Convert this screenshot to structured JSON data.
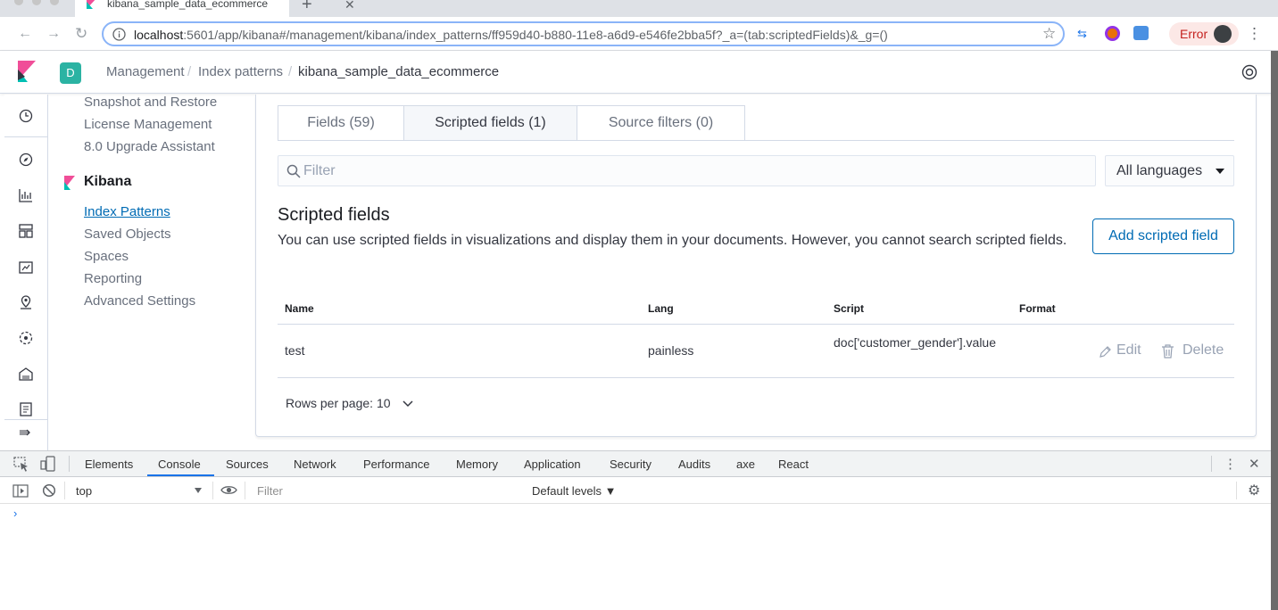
{
  "browser": {
    "tab_title": "kibana_sample_data_ecommerce",
    "new_tab": "+",
    "url_host": "localhost",
    "url_rest": ":5601/app/kibana#/management/kibana/index_patterns/ff959d40-b880-11e8-a6d9-e546fe2bba5f?_a=(tab:scriptedFields)&_g=()",
    "error_label": "Error"
  },
  "header": {
    "space_initial": "D",
    "breadcrumbs": [
      "Management",
      "Index patterns",
      "kibana_sample_data_ecommerce"
    ]
  },
  "sidebar": {
    "top_links": [
      "Snapshot and Restore",
      "License Management",
      "8.0 Upgrade Assistant"
    ],
    "section_title": "Kibana",
    "kibana_links": [
      "Index Patterns",
      "Saved Objects",
      "Spaces",
      "Reporting",
      "Advanced Settings"
    ]
  },
  "tabs": [
    {
      "label": "Fields (59)"
    },
    {
      "label": "Scripted fields (1)"
    },
    {
      "label": "Source filters (0)"
    }
  ],
  "filter": {
    "placeholder": "Filter"
  },
  "language_select": {
    "value": "All languages"
  },
  "scripted": {
    "title": "Scripted fields",
    "description": "You can use scripted fields in visualizations and display them in your documents. However, you cannot search scripted fields.",
    "add_button": "Add scripted field"
  },
  "table": {
    "columns": [
      "Name",
      "Lang",
      "Script",
      "Format"
    ],
    "rows": [
      {
        "name": "test",
        "lang": "painless",
        "script": "doc['customer_gender'].value",
        "format": "",
        "edit": "Edit",
        "delete": "Delete"
      }
    ],
    "rows_per_page": "Rows per page: 10"
  },
  "devtools": {
    "tabs": [
      "Elements",
      "Console",
      "Sources",
      "Network",
      "Performance",
      "Memory",
      "Application",
      "Security",
      "Audits",
      "axe",
      "React"
    ],
    "active_tab": "Console",
    "context": "top",
    "filter_placeholder": "Filter",
    "levels": "Default levels ▼",
    "prompt": "›"
  },
  "colors": {
    "accent": "#006bb4",
    "space_avatar": "#2bb3a3",
    "error_chip_bg": "#fce8e6",
    "error_text": "#c5221f"
  }
}
